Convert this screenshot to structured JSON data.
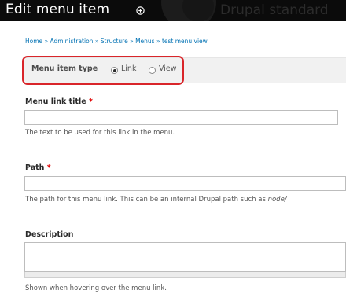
{
  "header": {
    "title": "Edit menu item",
    "background_text": "Drupal standard"
  },
  "breadcrumb": {
    "items": [
      "Home",
      "Administration",
      "Structure",
      "Menus",
      "test menu view"
    ],
    "separator": "»"
  },
  "menu_item_type": {
    "label": "Menu item type",
    "options": [
      {
        "label": "Link",
        "checked": true
      },
      {
        "label": "View",
        "checked": false
      }
    ]
  },
  "fields": {
    "title": {
      "label": "Menu link title",
      "required_marker": "*",
      "value": "",
      "help": "The text to be used for this link in the menu."
    },
    "path": {
      "label": "Path",
      "required_marker": "*",
      "value": "",
      "help": "The path for this menu link. This can be an internal Drupal path such as",
      "help_em": "node/"
    },
    "description": {
      "label": "Description",
      "value": "",
      "help": "Shown when hovering over the menu link."
    }
  },
  "colors": {
    "header_bg": "#0b0b0b",
    "link": "#0071b3",
    "required": "#e00000",
    "highlight": "#d9252a"
  }
}
